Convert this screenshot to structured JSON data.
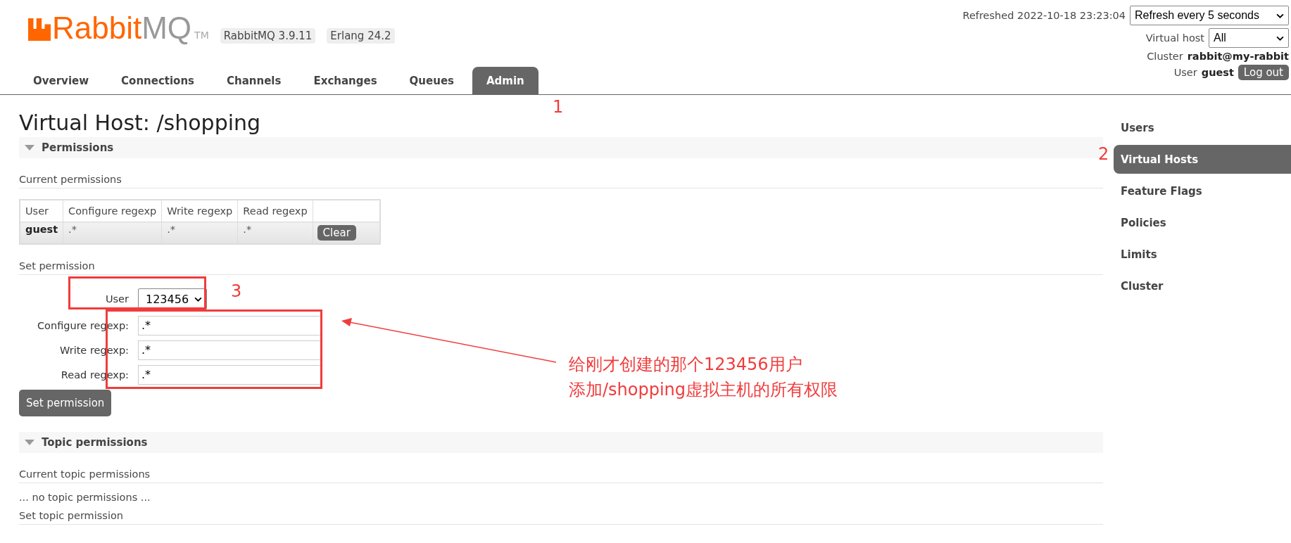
{
  "header": {
    "logo": {
      "brand": "Rabbit",
      "suffix": "MQ",
      "tm": "TM"
    },
    "versions": [
      "RabbitMQ 3.9.11",
      "Erlang 24.2"
    ],
    "refreshed": "Refreshed 2022-10-18 23:23:04",
    "refresh_select": "Refresh every 5 seconds",
    "vhost_label": "Virtual host",
    "vhost_select": "All",
    "cluster_label": "Cluster",
    "cluster": "rabbit@my-rabbit",
    "user_label": "User",
    "user": "guest",
    "logout": "Log out"
  },
  "tabs": [
    {
      "label": "Overview",
      "selected": false
    },
    {
      "label": "Connections",
      "selected": false
    },
    {
      "label": "Channels",
      "selected": false
    },
    {
      "label": "Exchanges",
      "selected": false
    },
    {
      "label": "Queues",
      "selected": false
    },
    {
      "label": "Admin",
      "selected": true
    }
  ],
  "sidebar": {
    "items": [
      {
        "label": "Users",
        "selected": false
      },
      {
        "label": "Virtual Hosts",
        "selected": true
      },
      {
        "label": "Feature Flags",
        "selected": false
      },
      {
        "label": "Policies",
        "selected": false
      },
      {
        "label": "Limits",
        "selected": false
      },
      {
        "label": "Cluster",
        "selected": false
      }
    ]
  },
  "page": {
    "title": "Virtual Host: /shopping",
    "permissions": {
      "heading": "Permissions",
      "expanded": true,
      "current_heading": "Current permissions",
      "table": {
        "columns": [
          "User",
          "Configure regexp",
          "Write regexp",
          "Read regexp"
        ],
        "rows": [
          {
            "user": "guest",
            "configure": ".*",
            "write": ".*",
            "read": ".*",
            "action": "Clear"
          }
        ]
      },
      "set_heading": "Set permission",
      "user_label": "User",
      "user_select": "123456",
      "fields": [
        {
          "label": "Configure regexp:",
          "value": ".*"
        },
        {
          "label": "Write regexp:",
          "value": ".*"
        },
        {
          "label": "Read regexp:",
          "value": ".*"
        }
      ],
      "submit": "Set permission"
    },
    "topic_permissions": {
      "heading": "Topic permissions",
      "expanded": true,
      "current_heading": "Current topic permissions",
      "empty": "... no topic permissions ...",
      "set_heading": "Set topic permission"
    }
  },
  "annotations": {
    "numbers": [
      "1",
      "2",
      "3"
    ],
    "note": [
      "给刚才创建的那个123456用户",
      "添加/shopping虚拟主机的所有权限"
    ]
  }
}
